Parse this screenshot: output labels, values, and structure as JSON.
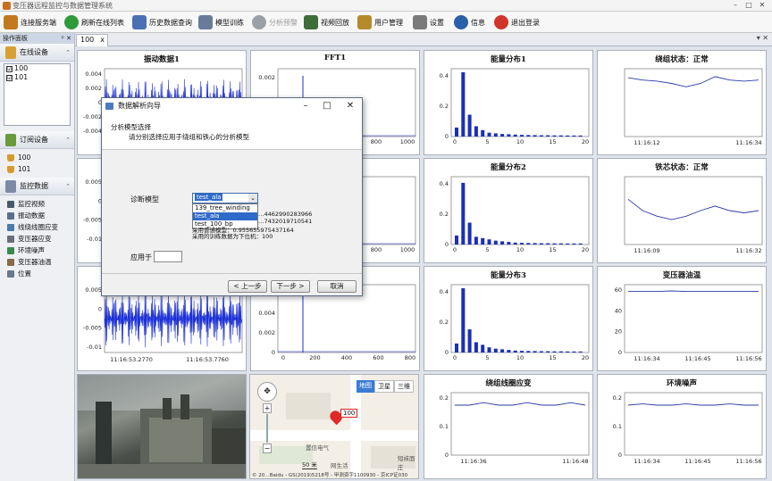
{
  "window": {
    "title": "变压器远程监控与数据管理系统",
    "min": "–",
    "max": "□",
    "close": "✕"
  },
  "toolbar": [
    {
      "label": "连接服务端",
      "icon": "server-connect-icon",
      "color": "#c2781f"
    },
    {
      "label": "刷新在线列表",
      "icon": "refresh-icon",
      "color": "#2f9a3a"
    },
    {
      "label": "历史数据查询",
      "icon": "history-query-icon",
      "color": "#4a6fb5"
    },
    {
      "label": "模型训练",
      "icon": "model-train-icon",
      "color": "#6a7a9a"
    },
    {
      "label": "分析预警",
      "icon": "analysis-alert-icon",
      "color": "#9aa0a6",
      "disabled": true
    },
    {
      "label": "视频回放",
      "icon": "video-playback-icon",
      "color": "#3d6e3a"
    },
    {
      "label": "用户管理",
      "icon": "user-manage-icon",
      "color": "#b58a2a"
    },
    {
      "label": "设置",
      "icon": "settings-icon",
      "color": "#7a7a7a"
    },
    {
      "label": "信息",
      "icon": "info-icon",
      "color": "#2b5faa"
    },
    {
      "label": "退出登录",
      "icon": "logout-icon",
      "color": "#d1342a"
    }
  ],
  "tab": {
    "label": "100",
    "close": "x",
    "ctrl": "▾ ✕"
  },
  "left": {
    "header": "操作面板",
    "pin": "ᵖ ✕",
    "online": {
      "title": "在线设备",
      "items": [
        {
          "check": "☑",
          "label": "100"
        },
        {
          "check": "☑",
          "label": "101"
        }
      ]
    },
    "subscribed": {
      "title": "订阅设备",
      "items": [
        "100",
        "101"
      ]
    },
    "monitor": {
      "title": "监控数据",
      "items": [
        "监控视频",
        "振动数据",
        "线绕线圈应变",
        "变压器应变",
        "环境噪声",
        "变压器油温",
        "位置"
      ]
    }
  },
  "panels": {
    "vib1": {
      "title": "振动数据1"
    },
    "fft1": {
      "title": "FFT1"
    },
    "e1": {
      "title": "能量分布1"
    },
    "state1": {
      "title": "绕组状态：正常"
    },
    "vib2": {
      "title": "振动数据2"
    },
    "fft2": {
      "title": "FFT2"
    },
    "e2": {
      "title": "能量分布2"
    },
    "state2": {
      "title": "铁芯状态：正常"
    },
    "vib3": {
      "title": "振动数据3"
    },
    "fft3": {
      "title": "FFT3"
    },
    "e3": {
      "title": "能量分布3"
    },
    "oil": {
      "title": "变压器油温"
    },
    "strain": {
      "title": "绕组线圈应变"
    },
    "noise": {
      "title": "环境噪声"
    }
  },
  "map": {
    "btn_map": "地图",
    "btn_sat": "卫星",
    "btn_3d": "三维",
    "marker": "100",
    "poi1": "置信电气",
    "scale": "50 米",
    "poi2": "网生活",
    "poi3": "短袜面庄",
    "copyright": "© 20…Baidu - GS(2019)5218号 - 甲测资字1100930 - 京ICP证030"
  },
  "dialog": {
    "title": "数据解析向导",
    "section": "分析模型选择",
    "desc": "请分别选择应用于绕组和铁心的分析模型",
    "label_model": "诊断模型",
    "select_value": "test_ala",
    "options": [
      "139_tree_winding",
      "test_ala",
      "test_100_bp"
    ],
    "info1": "…4462990283966",
    "info2": "…7432019710541",
    "info3": "采用普通模型：0.955655975437164",
    "info4": "采用的训练数据为下位机：100",
    "label_apply": "应用于",
    "btn_prev": "< 上一步",
    "btn_next": "下一步 >",
    "btn_cancel": "取消"
  },
  "chart_data": [
    {
      "id": "vib1",
      "type": "line",
      "title": "振动数据1",
      "ylim": [
        -0.004,
        0.004
      ],
      "ticks_y": [
        "0.004",
        "0.002",
        "0",
        "-0.002",
        "-0.004"
      ]
    },
    {
      "id": "fft1",
      "type": "line",
      "title": "FFT1",
      "ticks_y": [
        "0.002"
      ],
      "ticks_x": [
        "800",
        "1000"
      ],
      "peak": {
        "x": 100,
        "y": 0.0025
      }
    },
    {
      "id": "e1",
      "type": "bar",
      "title": "能量分布1",
      "ylim": [
        0,
        0.5
      ],
      "ticks_y": [
        "0.4",
        "0.2",
        "0"
      ],
      "ticks_x": [
        "0",
        "5",
        "10",
        "15",
        "20"
      ],
      "values": [
        0.07,
        0.5,
        0.17,
        0.08,
        0.05,
        0.03,
        0.025,
        0.02,
        0.018,
        0.015,
        0.013,
        0.012,
        0.011,
        0.01,
        0.01,
        0.009,
        0.009,
        0.008,
        0.008,
        0.008
      ]
    },
    {
      "id": "state1",
      "type": "line",
      "title": "绕组状态：正常",
      "x_ticks": [
        "11:16:12",
        "11:16:34"
      ],
      "values": [
        0.82,
        0.8,
        0.79,
        0.77,
        0.74,
        0.77,
        0.83,
        0.8,
        0.79,
        0.8
      ]
    },
    {
      "id": "vib2",
      "type": "line",
      "title": "振动数据2",
      "ticks_y": [
        "0.005",
        "0",
        "-0.005",
        "-0.01"
      ]
    },
    {
      "id": "fft2",
      "type": "line",
      "title": "FFT2",
      "ticks_x": [
        "800",
        "1000"
      ]
    },
    {
      "id": "e2",
      "type": "bar",
      "title": "能量分布2",
      "ylim": [
        0,
        0.5
      ],
      "ticks_y": [
        "0.4",
        "0.2",
        "0"
      ],
      "ticks_x": [
        "0",
        "5",
        "10",
        "15",
        "20"
      ],
      "values": [
        0.07,
        0.48,
        0.17,
        0.06,
        0.05,
        0.04,
        0.03,
        0.025,
        0.02,
        0.015,
        0.013,
        0.012,
        0.011,
        0.01,
        0.01,
        0.009,
        0.009,
        0.008,
        0.008,
        0.008
      ]
    },
    {
      "id": "state2",
      "type": "line",
      "title": "铁芯状态：正常",
      "x_ticks": [
        "11:16:09",
        "11:16:32"
      ],
      "values": [
        0.7,
        0.6,
        0.55,
        0.52,
        0.55,
        0.6,
        0.64,
        0.6,
        0.58,
        0.6
      ]
    },
    {
      "id": "vib3",
      "type": "line",
      "title": "振动数据3",
      "x_ticks": [
        "11:16:53.2770",
        "11:16:53.7760"
      ],
      "ticks_y": [
        "0.005",
        "0",
        "-0.005",
        "-0.01"
      ]
    },
    {
      "id": "fft3",
      "type": "line",
      "title": "FFT3",
      "ticks_y": [
        "0.006",
        "0.004",
        "0.002",
        "0"
      ],
      "ticks_x": [
        "0",
        "200",
        "400",
        "600",
        "800"
      ]
    },
    {
      "id": "e3",
      "type": "bar",
      "title": "能量分布3",
      "ylim": [
        0,
        0.5
      ],
      "ticks_y": [
        "0.4",
        "0.2",
        "0"
      ],
      "ticks_x": [
        "0",
        "5",
        "10",
        "15",
        "20"
      ],
      "values": [
        0.07,
        0.5,
        0.18,
        0.08,
        0.06,
        0.04,
        0.03,
        0.025,
        0.02,
        0.015,
        0.013,
        0.012,
        0.011,
        0.01,
        0.01,
        0.009,
        0.009,
        0.008,
        0.008,
        0.008
      ]
    },
    {
      "id": "oil",
      "type": "line",
      "title": "变压器油温",
      "ylim": [
        0,
        60
      ],
      "ticks_y": [
        "60",
        "40",
        "20",
        "0"
      ],
      "x_ticks": [
        "11:16:34",
        "11:16:45",
        "11:16:56"
      ],
      "values": [
        54,
        54,
        54,
        54.5,
        54,
        54,
        54,
        54,
        54,
        54
      ]
    },
    {
      "id": "strain",
      "type": "line",
      "title": "绕组线圈应变",
      "ylim": [
        0,
        0.25
      ],
      "ticks_y": [
        "0.2",
        "0.1",
        "0"
      ],
      "x_ticks": [
        "11:16:36",
        "11:16:48"
      ],
      "values": [
        0.2,
        0.2,
        0.21,
        0.2,
        0.2,
        0.21,
        0.2,
        0.2,
        0.21,
        0.2
      ]
    },
    {
      "id": "noise",
      "type": "line",
      "title": "环境噪声",
      "ylim": [
        0,
        0.25
      ],
      "ticks_y": [
        "0.2",
        "0.1",
        "0"
      ],
      "x_ticks": [
        "11:16:34",
        "11:16:45",
        "11:16:56"
      ],
      "values": [
        0.2,
        0.205,
        0.2,
        0.2,
        0.205,
        0.2,
        0.2,
        0.205,
        0.2,
        0.2
      ]
    }
  ]
}
